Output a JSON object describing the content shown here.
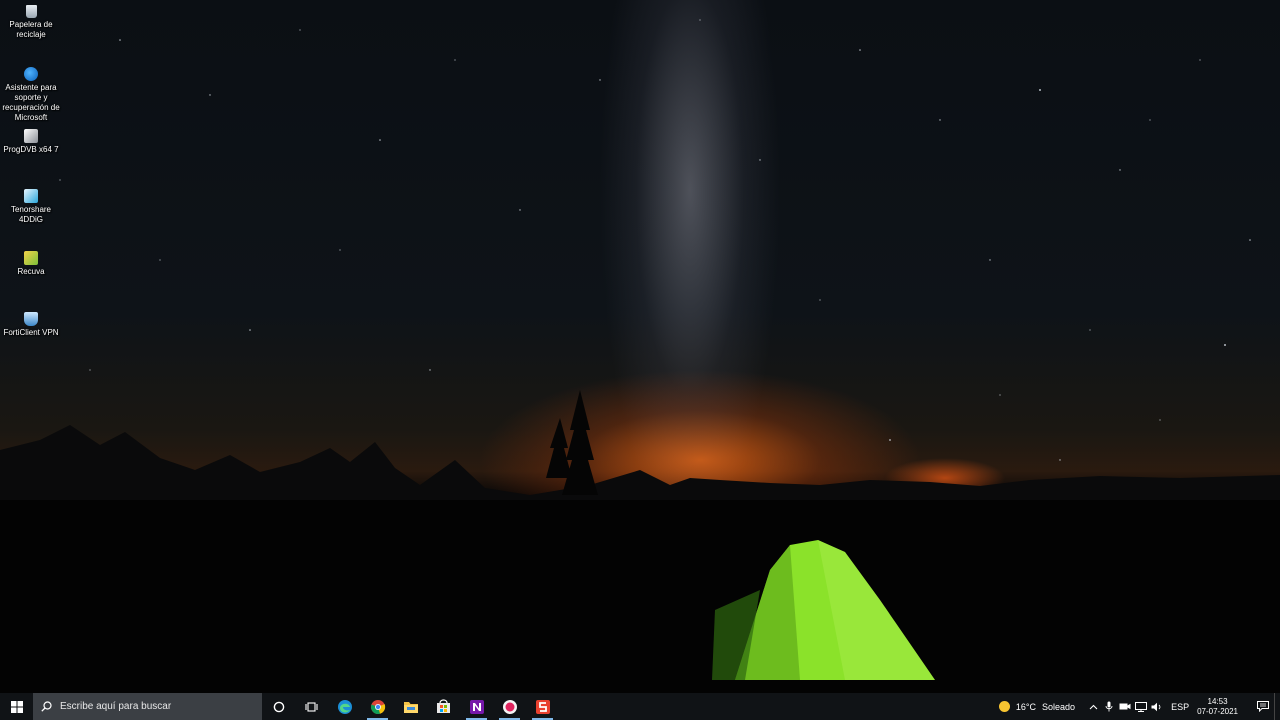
{
  "desktop": {
    "icons": [
      {
        "label": "Papelera de reciclaje",
        "icon": "recycle-bin-icon"
      },
      {
        "label": "Asistente para soporte y recuperación de Microsoft",
        "icon": "microsoft-support-icon"
      },
      {
        "label": "ProgDVB x64 7",
        "icon": "progdvb-icon"
      },
      {
        "label": "Tenorshare 4DDiG",
        "icon": "tenorshare-icon"
      },
      {
        "label": "Recuva",
        "icon": "recuva-icon"
      },
      {
        "label": "FortiClient VPN",
        "icon": "forticlient-icon"
      }
    ]
  },
  "taskbar": {
    "search_placeholder": "Escribe aquí para buscar",
    "pinned_apps": [
      "cortana",
      "task-view",
      "edge",
      "chrome",
      "file-explorer",
      "microsoft-store",
      "onenote",
      "screen-recorder",
      "wps-office"
    ],
    "weather": {
      "temperature": "16°C",
      "condition": "Soleado"
    },
    "language": "ESP",
    "time": "14:53",
    "date": "07-07-2021"
  },
  "colors": {
    "taskbar_bg": "#101316",
    "search_bg": "#3b3f44",
    "tent_green": "#8be22a",
    "horizon_glow": "#ff6e14"
  }
}
